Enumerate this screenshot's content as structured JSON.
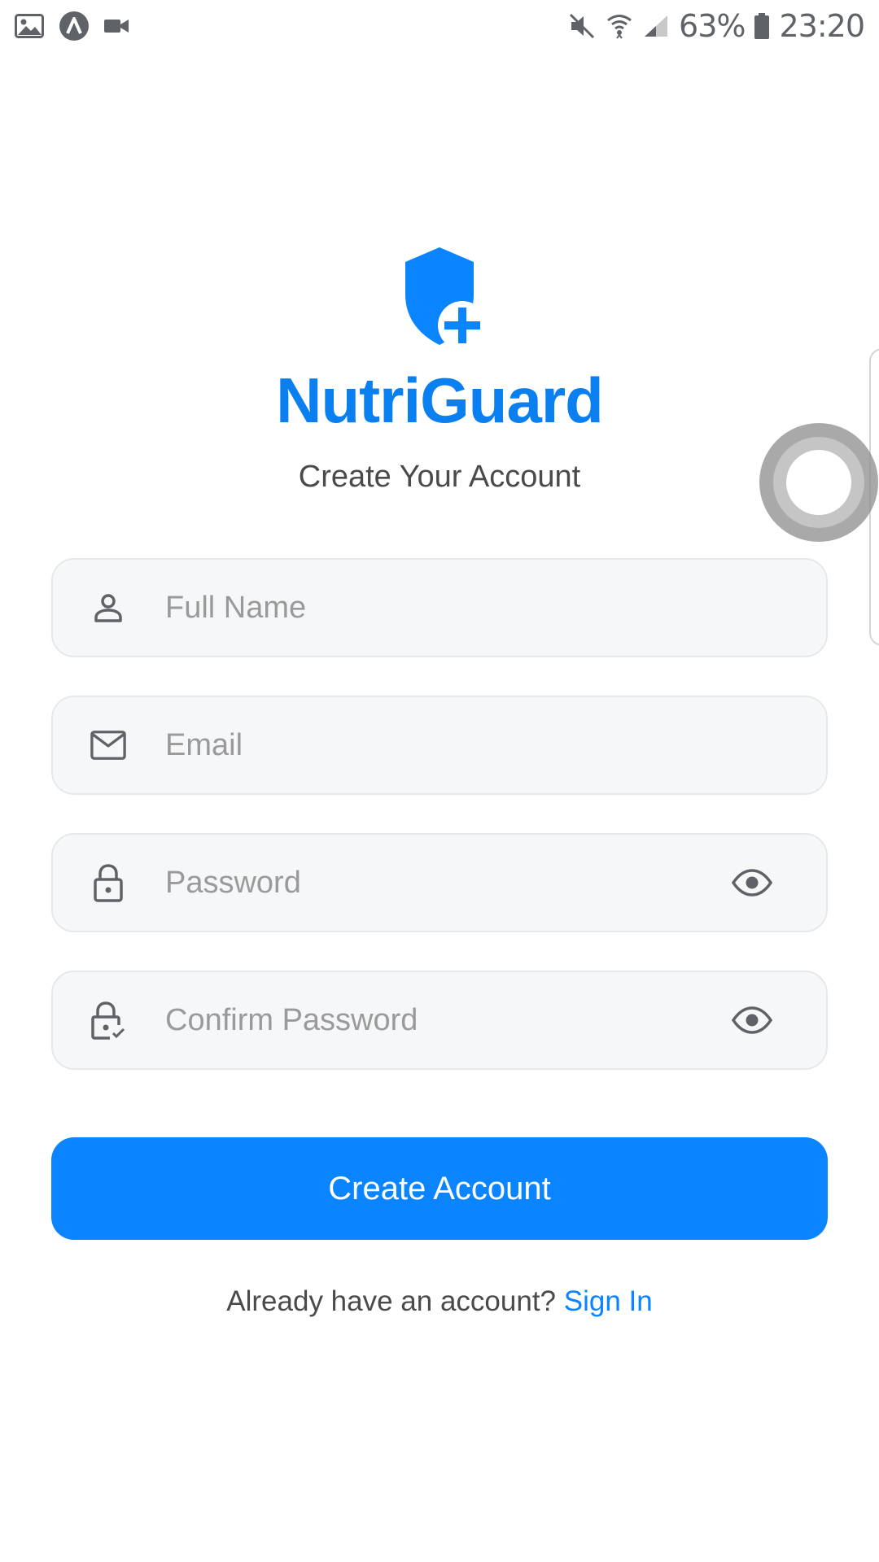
{
  "status_bar": {
    "left_icons": [
      "gallery-icon",
      "app-a-icon",
      "video-camera-icon"
    ],
    "right_icons": [
      "mute-icon",
      "wifi-icon",
      "signal-icon",
      "battery-icon"
    ],
    "battery": "63%",
    "time": "23:20"
  },
  "brand": {
    "logo_icon": "shield-plus-icon",
    "app_name": "NutriGuard",
    "subtitle": "Create Your Account"
  },
  "form": {
    "full_name": {
      "placeholder": "Full Name",
      "value": "",
      "icon": "person-icon"
    },
    "email": {
      "placeholder": "Email",
      "value": "",
      "icon": "mail-icon"
    },
    "password": {
      "placeholder": "Password",
      "value": "",
      "icon": "lock-icon",
      "toggle_icon": "eye-icon"
    },
    "confirm_password": {
      "placeholder": "Confirm Password",
      "value": "",
      "icon": "lock-check-icon",
      "toggle_icon": "eye-icon"
    },
    "submit_label": "Create Account"
  },
  "footer": {
    "prompt": "Already have an account?",
    "link": "Sign In"
  },
  "colors": {
    "accent": "#0a84ff",
    "brand_text": "#0a7ff0",
    "field_bg": "#f6f7f9",
    "field_border": "#e6e8eb",
    "placeholder": "#9a9a9a"
  }
}
